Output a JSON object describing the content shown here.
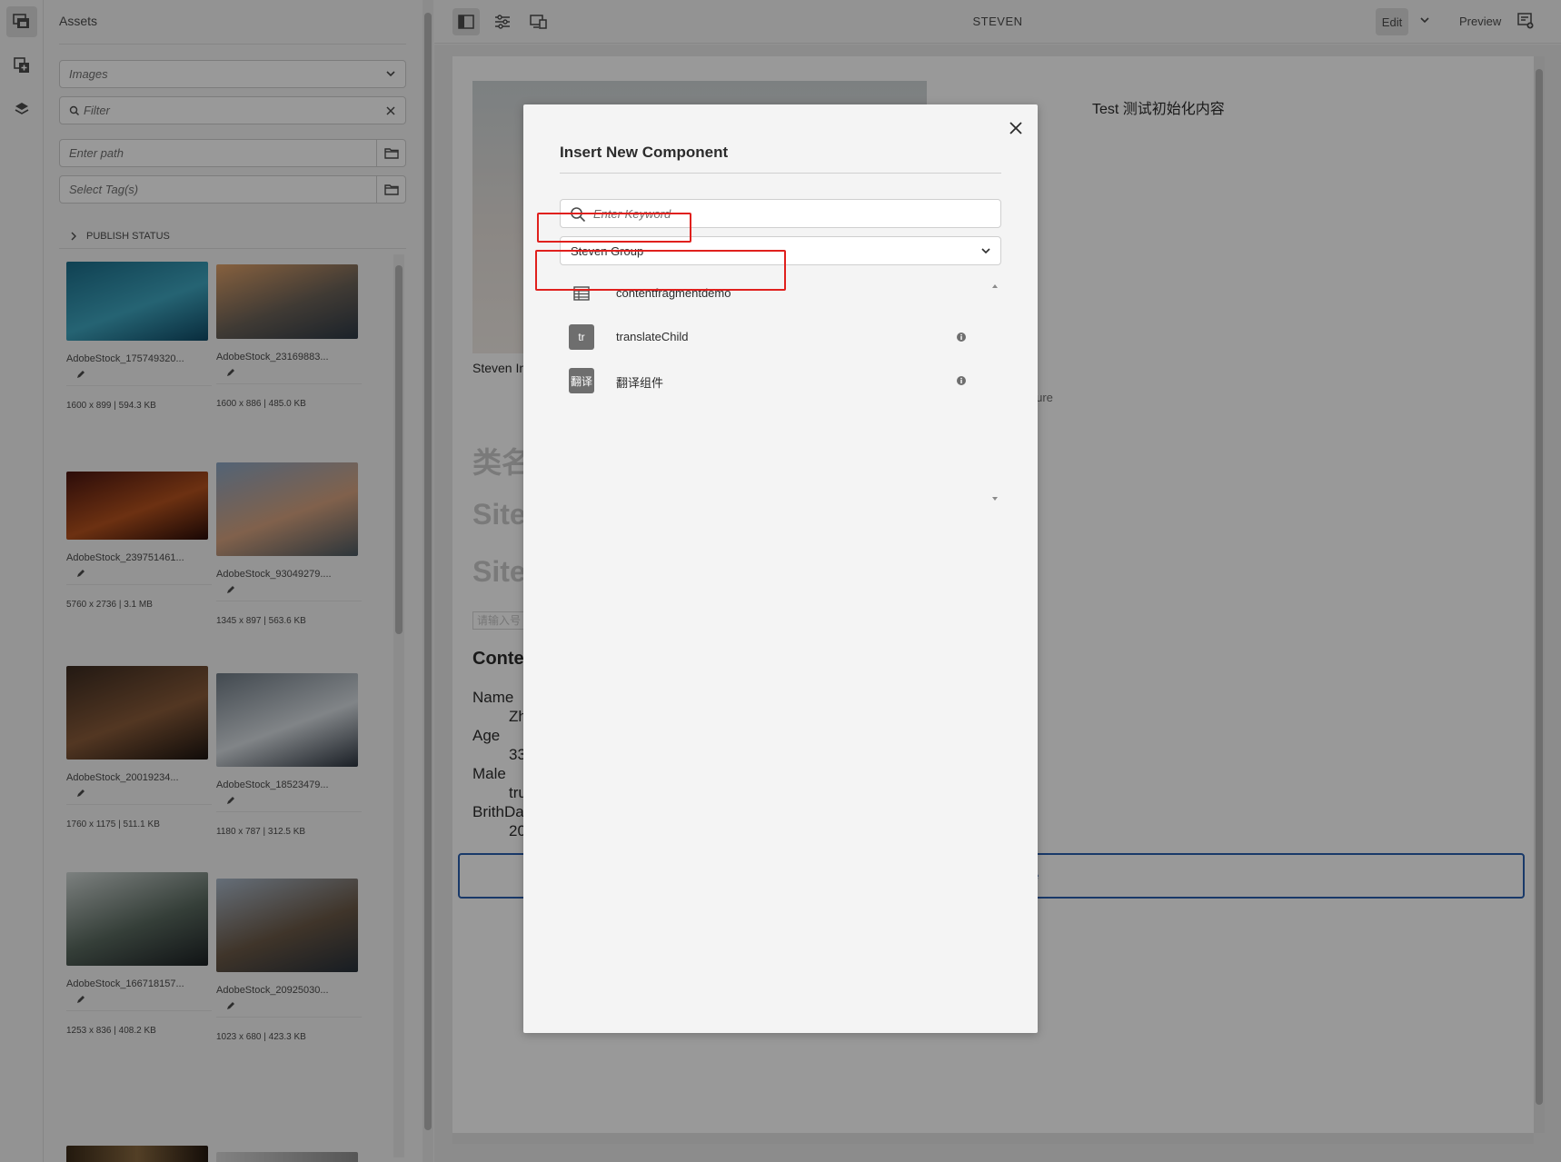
{
  "assets_panel": {
    "title": "Assets",
    "asset_type": "Images",
    "filter_placeholder": "Filter",
    "path_placeholder": "Enter path",
    "tags_placeholder": "Select Tag(s)",
    "publish_status_label": "PUBLISH STATUS",
    "cards": [
      {
        "name": "AdobeStock_175749320...",
        "meta": "1600 x 899 | 594.3 KB",
        "colors": [
          "#1b6d8a",
          "#3fa6c0",
          "#0f4a66"
        ]
      },
      {
        "name": "AdobeStock_23169883...",
        "meta": "1600 x 886 | 485.0 KB",
        "colors": [
          "#e0a169",
          "#6b6258",
          "#2d3946"
        ]
      },
      {
        "name": "AdobeStock_239751461...",
        "meta": "5760 x 2736 | 3.1 MB",
        "colors": [
          "#4a1510",
          "#b5521e",
          "#2a0c08"
        ]
      },
      {
        "name": "AdobeStock_93049279....",
        "meta": "1345 x 897 | 563.6 KB",
        "colors": [
          "#8aa6c4",
          "#d6a27f",
          "#4b5a63"
        ]
      },
      {
        "name": "AdobeStock_20019234...",
        "meta": "1760 x 1175 | 511.1 KB",
        "colors": [
          "#3a2a20",
          "#8a5c3a",
          "#1c1410"
        ]
      },
      {
        "name": "AdobeStock_18523479...",
        "meta": "1180 x 787 | 312.5 KB",
        "colors": [
          "#6f7b86",
          "#d7dde2",
          "#2d3540"
        ]
      },
      {
        "name": "AdobeStock_166718157...",
        "meta": "1253 x 836 | 408.2 KB",
        "colors": [
          "#cfd6d4",
          "#59695f",
          "#1c2124"
        ]
      },
      {
        "name": "AdobeStock_20925030...",
        "meta": "1023 x 680 | 423.3 KB",
        "colors": [
          "#a9b8c9",
          "#6a5846",
          "#27303a"
        ]
      }
    ]
  },
  "toolbar": {
    "page_title": "STEVEN",
    "edit_label": "Edit",
    "preview_label": "Preview"
  },
  "page": {
    "heading_right": "Test 测试初始化内容",
    "image_caption": "Steven In",
    "configure_text": "igure",
    "heading_cn": "类名",
    "site_1": "Site",
    "site_2": "Site",
    "input_placeholder": "请输入号",
    "content_heading": "Conte",
    "fields": [
      {
        "label": "Name",
        "value": "Zh"
      },
      {
        "label": "Age",
        "value": "33"
      },
      {
        "label": "Male",
        "value": "tru"
      },
      {
        "label": "BrithDa",
        "value": "20"
      }
    ],
    "drop_zone_text": "ere"
  },
  "dialog": {
    "title": "Insert New Component",
    "search_placeholder": "Enter Keyword",
    "group_selected": "Steven Group",
    "components": [
      {
        "label": "contentfragmentdemo",
        "icon": "table-icon",
        "icon_text": ""
      },
      {
        "label": "translateChild",
        "icon": "tr-abbr-icon",
        "icon_text": "tr"
      },
      {
        "label": "翻译组件",
        "icon": "cn-abbr-icon",
        "icon_text": "翻译"
      }
    ]
  },
  "colors": {
    "highlight": "#e0201d",
    "accent_blue": "#2a5fb0",
    "overlay": "rgba(0,0,0,0.4)"
  }
}
